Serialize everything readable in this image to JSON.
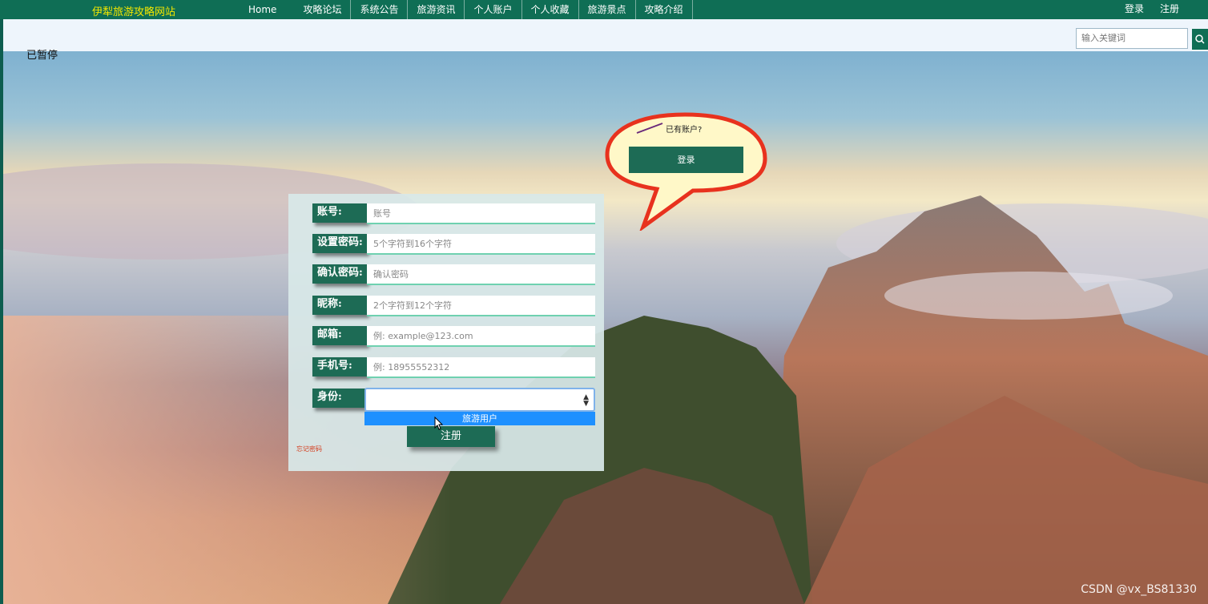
{
  "nav": {
    "brand": "伊犁旅游攻略网站",
    "links": [
      "Home",
      "攻略论坛",
      "系统公告",
      "旅游资讯",
      "个人账户",
      "个人收藏",
      "旅游景点",
      "攻略介绍"
    ],
    "login": "登录",
    "register": "注册"
  },
  "search": {
    "placeholder": "输入关键词"
  },
  "status": {
    "paused": "已暂停"
  },
  "bubble": {
    "prompt": "已有账户?",
    "login_button": "登录"
  },
  "form": {
    "fields": [
      {
        "label": "账号:",
        "placeholder": "账号"
      },
      {
        "label": "设置密码:",
        "placeholder": "5个字符到16个字符"
      },
      {
        "label": "确认密码:",
        "placeholder": "确认密码"
      },
      {
        "label": "昵称:",
        "placeholder": "2个字符到12个字符"
      },
      {
        "label": "邮箱:",
        "placeholder": "例: example@123.com"
      },
      {
        "label": "手机号:",
        "placeholder": "例: 18955552312"
      }
    ],
    "role_label": "身份:",
    "role_value": "",
    "role_option": "旅游用户",
    "submit": "注册",
    "forgot": "忘记密码"
  },
  "watermark": "CSDN @vx_BS81330",
  "colors": {
    "nav_bg": "#0f6e55",
    "brand": "#f2e600",
    "button": "#1d6b55",
    "option_highlight": "#1e90ff",
    "bubble_border": "#e8321e",
    "bubble_fill": "#fff8c8"
  }
}
